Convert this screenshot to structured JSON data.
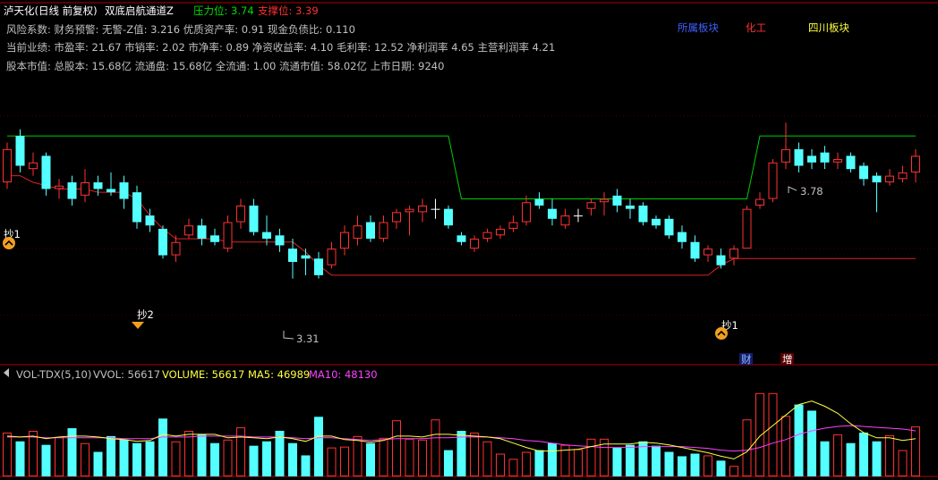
{
  "header": {
    "stock": "泸天化(日线 前复权)",
    "indicator": "双底启航通道Z",
    "pressure_label": "压力位: 3.74",
    "support_label": "支撑位: 3.39",
    "info_line_1": "风险系数: 财务预警: 无警-Z值: 3.216 优质资产率: 0.91 现金负债比: 0.110",
    "info_line_2": "当前业绩: 市盈率: 21.67 市销率: 2.02 市净率: 0.89 净资收益率: 4.10 毛利率: 12.52 净利润率 4.65 主营利润率 4.21",
    "info_line_3": "股本市值: 总股本: 15.68亿 流通盘: 15.68亿 全流通: 1.00 流通市值: 58.02亿 上市日期: 9240",
    "sectors": [
      "所属板块",
      "化工",
      "四川板块"
    ]
  },
  "annotations": {
    "high_label": "3.78",
    "low_label": "3.31",
    "buy1": "抄1",
    "buy2": "抄2",
    "buy3": "抄1",
    "tag_cai": "财",
    "tag_zeng": "增"
  },
  "volume_header": {
    "name": "VOL-TDX(5,10)",
    "vvol": "VVOL: 56617",
    "volume": "VOLUME: 56617",
    "ma5": "MA5: 46989",
    "ma10": "MA10: 48130"
  },
  "colors": {
    "up": "#ff3232",
    "down": "#54ffff",
    "doji": "#ffffff",
    "resistance": "#00cc00",
    "support": "#dd2222",
    "ma5": "#ffff40",
    "ma10": "#ff40ff",
    "axis": "#b00000"
  },
  "chart_data": [
    {
      "type": "candlestick",
      "title": "泸天化(日线 前复权)",
      "series_fields": [
        "open",
        "close",
        "high",
        "low"
      ],
      "ohlc": [
        [
          3.6,
          3.7,
          3.72,
          3.58
        ],
        [
          3.74,
          3.65,
          3.76,
          3.63
        ],
        [
          3.64,
          3.66,
          3.69,
          3.62
        ],
        [
          3.68,
          3.58,
          3.69,
          3.56
        ],
        [
          3.58,
          3.59,
          3.61,
          3.55
        ],
        [
          3.6,
          3.55,
          3.62,
          3.53
        ],
        [
          3.56,
          3.6,
          3.64,
          3.54
        ],
        [
          3.6,
          3.58,
          3.62,
          3.56
        ],
        [
          3.58,
          3.57,
          3.63,
          3.56
        ],
        [
          3.6,
          3.55,
          3.62,
          3.52
        ],
        [
          3.57,
          3.48,
          3.59,
          3.46
        ],
        [
          3.5,
          3.47,
          3.52,
          3.45
        ],
        [
          3.46,
          3.38,
          3.47,
          3.37
        ],
        [
          3.38,
          3.42,
          3.44,
          3.36
        ],
        [
          3.44,
          3.47,
          3.49,
          3.43
        ],
        [
          3.47,
          3.43,
          3.49,
          3.41
        ],
        [
          3.44,
          3.42,
          3.46,
          3.41
        ],
        [
          3.4,
          3.48,
          3.5,
          3.39
        ],
        [
          3.48,
          3.53,
          3.55,
          3.46
        ],
        [
          3.53,
          3.45,
          3.55,
          3.44
        ],
        [
          3.45,
          3.43,
          3.5,
          3.41
        ],
        [
          3.44,
          3.41,
          3.46,
          3.39
        ],
        [
          3.4,
          3.36,
          3.43,
          3.31
        ],
        [
          3.38,
          3.37,
          3.4,
          3.32
        ],
        [
          3.37,
          3.32,
          3.39,
          3.31
        ],
        [
          3.35,
          3.4,
          3.42,
          3.34
        ],
        [
          3.4,
          3.45,
          3.47,
          3.38
        ],
        [
          3.43,
          3.47,
          3.5,
          3.41
        ],
        [
          3.48,
          3.43,
          3.5,
          3.42
        ],
        [
          3.43,
          3.48,
          3.5,
          3.42
        ],
        [
          3.48,
          3.51,
          3.52,
          3.46
        ],
        [
          3.51,
          3.52,
          3.53,
          3.44
        ],
        [
          3.51,
          3.53,
          3.55,
          3.48
        ],
        [
          3.52,
          3.52,
          3.55,
          3.49
        ],
        [
          3.52,
          3.47,
          3.53,
          3.46
        ],
        [
          3.44,
          3.42,
          3.45,
          3.41
        ],
        [
          3.4,
          3.43,
          3.44,
          3.39
        ],
        [
          3.43,
          3.45,
          3.46,
          3.42
        ],
        [
          3.44,
          3.46,
          3.47,
          3.43
        ],
        [
          3.46,
          3.48,
          3.5,
          3.45
        ],
        [
          3.48,
          3.54,
          3.56,
          3.47
        ],
        [
          3.55,
          3.53,
          3.57,
          3.52
        ],
        [
          3.52,
          3.49,
          3.55,
          3.47
        ],
        [
          3.47,
          3.5,
          3.52,
          3.46
        ],
        [
          3.5,
          3.5,
          3.52,
          3.48
        ],
        [
          3.52,
          3.54,
          3.55,
          3.5
        ],
        [
          3.54,
          3.55,
          3.57,
          3.5
        ],
        [
          3.56,
          3.53,
          3.58,
          3.51
        ],
        [
          3.53,
          3.52,
          3.55,
          3.49
        ],
        [
          3.53,
          3.48,
          3.54,
          3.47
        ],
        [
          3.49,
          3.47,
          3.5,
          3.46
        ],
        [
          3.49,
          3.44,
          3.5,
          3.43
        ],
        [
          3.45,
          3.42,
          3.47,
          3.4
        ],
        [
          3.42,
          3.37,
          3.44,
          3.36
        ],
        [
          3.38,
          3.4,
          3.41,
          3.36
        ],
        [
          3.38,
          3.35,
          3.4,
          3.34
        ],
        [
          3.37,
          3.4,
          3.41,
          3.35
        ],
        [
          3.4,
          3.52,
          3.53,
          3.4
        ],
        [
          3.53,
          3.55,
          3.57,
          3.52
        ],
        [
          3.55,
          3.66,
          3.67,
          3.54
        ],
        [
          3.66,
          3.7,
          3.78,
          3.64
        ],
        [
          3.7,
          3.65,
          3.72,
          3.63
        ],
        [
          3.68,
          3.66,
          3.7,
          3.64
        ],
        [
          3.69,
          3.66,
          3.71,
          3.64
        ],
        [
          3.66,
          3.67,
          3.69,
          3.64
        ],
        [
          3.68,
          3.64,
          3.69,
          3.63
        ],
        [
          3.65,
          3.61,
          3.66,
          3.59
        ],
        [
          3.62,
          3.6,
          3.63,
          3.51
        ],
        [
          3.6,
          3.62,
          3.64,
          3.59
        ],
        [
          3.61,
          3.63,
          3.65,
          3.6
        ],
        [
          3.63,
          3.68,
          3.7,
          3.6
        ]
      ],
      "resistance": [
        3.74,
        3.74,
        3.74,
        3.74,
        3.74,
        3.74,
        3.74,
        3.74,
        3.74,
        3.74,
        3.74,
        3.74,
        3.74,
        3.74,
        3.74,
        3.74,
        3.74,
        3.74,
        3.74,
        3.74,
        3.74,
        3.74,
        3.74,
        3.74,
        3.74,
        3.74,
        3.74,
        3.74,
        3.74,
        3.74,
        3.74,
        3.74,
        3.74,
        3.74,
        3.74,
        3.55,
        3.55,
        3.55,
        3.55,
        3.55,
        3.55,
        3.55,
        3.55,
        3.55,
        3.55,
        3.55,
        3.55,
        3.55,
        3.55,
        3.55,
        3.55,
        3.55,
        3.55,
        3.55,
        3.55,
        3.55,
        3.55,
        3.55,
        3.74,
        3.74,
        3.74,
        3.74,
        3.74,
        3.74,
        3.74,
        3.74,
        3.74,
        3.74,
        3.74,
        3.74,
        3.74
      ],
      "support": [
        3.62,
        3.62,
        3.6,
        3.59,
        3.58,
        3.58,
        3.58,
        3.57,
        3.57,
        3.57,
        3.55,
        3.5,
        3.46,
        3.43,
        3.43,
        3.43,
        3.43,
        3.42,
        3.42,
        3.42,
        3.42,
        3.42,
        3.42,
        3.39,
        3.35,
        3.32,
        3.32,
        3.32,
        3.32,
        3.32,
        3.32,
        3.32,
        3.32,
        3.32,
        3.32,
        3.32,
        3.32,
        3.32,
        3.32,
        3.32,
        3.32,
        3.32,
        3.32,
        3.32,
        3.32,
        3.32,
        3.32,
        3.32,
        3.32,
        3.32,
        3.32,
        3.32,
        3.32,
        3.32,
        3.32,
        3.35,
        3.37,
        3.37,
        3.37,
        3.37,
        3.37,
        3.37,
        3.37,
        3.37,
        3.37,
        3.37,
        3.37,
        3.37,
        3.37,
        3.37,
        3.37
      ],
      "ylim": [
        3.05,
        4.15
      ]
    },
    {
      "type": "bar",
      "title": "VOL-TDX(5,10)",
      "values": [
        50000,
        40000,
        52000,
        36000,
        45000,
        55000,
        38000,
        28000,
        46000,
        42000,
        38000,
        40000,
        66000,
        40000,
        52000,
        48000,
        38000,
        42000,
        56000,
        35000,
        40000,
        52000,
        38000,
        24000,
        68000,
        33000,
        34000,
        46000,
        38000,
        44000,
        64000,
        43000,
        42000,
        65000,
        30000,
        52000,
        50000,
        40000,
        26000,
        20000,
        28000,
        30000,
        38000,
        36000,
        31000,
        43000,
        43000,
        33000,
        36000,
        40000,
        35000,
        28000,
        23000,
        26000,
        24000,
        18000,
        12000,
        65000,
        95000,
        95000,
        69000,
        82000,
        75000,
        40000,
        48000,
        38000,
        50000,
        40000,
        47000,
        30000,
        57000
      ],
      "ma5": [
        46000,
        45000,
        46000,
        43000,
        45000,
        46000,
        46000,
        45000,
        43000,
        42000,
        40000,
        41000,
        48000,
        46000,
        48000,
        48000,
        48000,
        44000,
        45000,
        44000,
        43000,
        45000,
        43000,
        40000,
        46000,
        46000,
        42000,
        41000,
        39000,
        41000,
        46000,
        46000,
        45000,
        48000,
        48000,
        47000,
        46000,
        45000,
        43000,
        38000,
        33000,
        29000,
        29000,
        30000,
        31000,
        34000,
        37000,
        37000,
        37000,
        39000,
        38000,
        36000,
        33000,
        30000,
        27000,
        23000,
        20000,
        28000,
        46000,
        58000,
        70000,
        82000,
        86000,
        80000,
        72000,
        60000,
        50000,
        44000,
        44000,
        41000,
        43000
      ],
      "ma10": [
        45000,
        45000,
        45000,
        44000,
        44000,
        44000,
        44000,
        44000,
        44000,
        43000,
        43000,
        43000,
        45000,
        45000,
        45000,
        46000,
        46000,
        46000,
        46000,
        45000,
        45000,
        45000,
        44000,
        43000,
        44000,
        44000,
        43000,
        42000,
        41000,
        42000,
        43000,
        43000,
        43000,
        44000,
        44000,
        45000,
        45000,
        45000,
        44000,
        43000,
        41000,
        40000,
        38000,
        36000,
        35000,
        34000,
        33000,
        33000,
        33000,
        34000,
        34000,
        34000,
        34000,
        33000,
        32000,
        30000,
        29000,
        30000,
        33000,
        38000,
        42000,
        48000,
        52000,
        55000,
        57000,
        58000,
        57000,
        56000,
        55000,
        54000,
        52000
      ],
      "ylim": [
        0,
        105000
      ]
    }
  ]
}
